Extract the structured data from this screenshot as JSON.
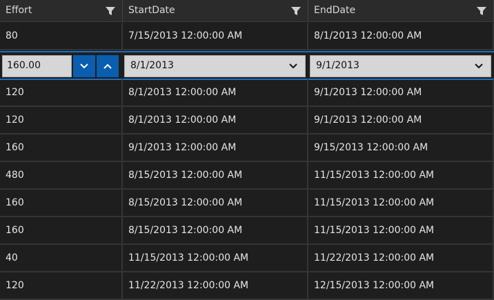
{
  "columns": [
    {
      "label": "Effort",
      "filter_icon": "filter-icon"
    },
    {
      "label": "StartDate",
      "filter_icon": "filter-icon"
    },
    {
      "label": "EndDate",
      "filter_icon": "filter-icon"
    }
  ],
  "rows_before": [
    {
      "effort": "80",
      "start": "7/15/2013 12:00:00 AM",
      "end": "8/1/2013 12:00:00 AM"
    }
  ],
  "edit_row": {
    "effort_value": "160.00",
    "start_value": "8/1/2013",
    "end_value": "9/1/2013",
    "accent_color": "#1e6fbd"
  },
  "rows_after": [
    {
      "effort": "120",
      "start": "8/1/2013 12:00:00 AM",
      "end": "9/1/2013 12:00:00 AM"
    },
    {
      "effort": "120",
      "start": "8/1/2013 12:00:00 AM",
      "end": "9/1/2013 12:00:00 AM"
    },
    {
      "effort": "160",
      "start": "9/1/2013 12:00:00 AM",
      "end": "9/15/2013 12:00:00 AM"
    },
    {
      "effort": "480",
      "start": "8/15/2013 12:00:00 AM",
      "end": "11/15/2013 12:00:00 AM"
    },
    {
      "effort": "160",
      "start": "8/15/2013 12:00:00 AM",
      "end": "11/15/2013 12:00:00 AM"
    },
    {
      "effort": "160",
      "start": "8/15/2013 12:00:00 AM",
      "end": "11/15/2013 12:00:00 AM"
    },
    {
      "effort": "40",
      "start": "11/15/2013 12:00:00 AM",
      "end": "11/22/2013 12:00:00 AM"
    },
    {
      "effort": "120",
      "start": "11/22/2013 12:00:00 AM",
      "end": "12/15/2013 12:00:00 AM"
    }
  ]
}
